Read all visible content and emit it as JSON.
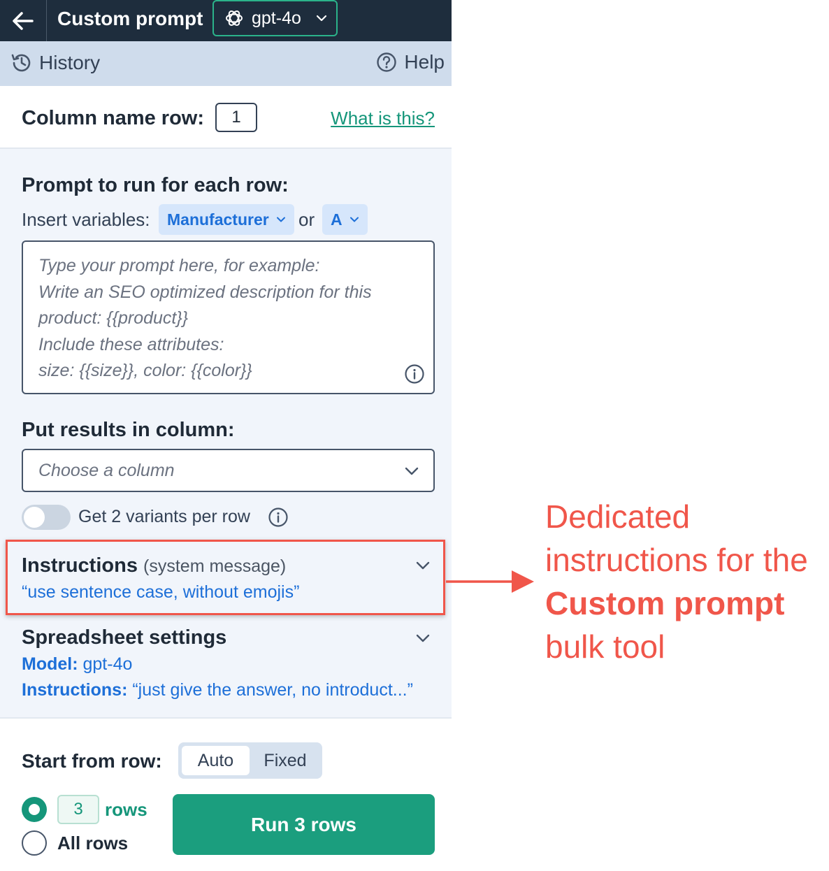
{
  "header": {
    "title": "Custom prompt",
    "model": "gpt-4o"
  },
  "toolbar": {
    "history_label": "History",
    "help_label": "Help"
  },
  "column_name_row": {
    "label": "Column name row:",
    "value": "1",
    "link": "What is this?"
  },
  "prompt": {
    "heading": "Prompt to run for each row:",
    "insert_label": "Insert variables:",
    "variable_1": "Manufacturer",
    "or_label": "or",
    "variable_2": "A",
    "placeholder": "Type your prompt here, for example:\nWrite an SEO optimized description for this\nproduct: {{product}}\nInclude these attributes:\nsize: {{size}}, color: {{color}}"
  },
  "results": {
    "heading": "Put results in column:",
    "placeholder": "Choose a column",
    "variants_label": "Get 2 variants per row",
    "variants_enabled": false
  },
  "instructions": {
    "title": "Instructions",
    "subtitle": "(system message)",
    "value": "“use sentence case, without emojis”"
  },
  "spreadsheet_settings": {
    "heading": "Spreadsheet settings",
    "model_key": "Model:",
    "model_value": "gpt-4o",
    "instructions_key": "Instructions:",
    "instructions_value": "“just give the answer, no introduct...”"
  },
  "start": {
    "label": "Start from row:",
    "option_auto": "Auto",
    "option_fixed": "Fixed",
    "selected": "Auto",
    "rows_value": "3",
    "rows_label": "rows",
    "all_rows_label": "All rows",
    "run_button": "Run 3 rows"
  },
  "annotation": {
    "line1": "Dedicated",
    "line2": "instructions for the",
    "line3_bold": "Custom prompt",
    "line4": "bulk tool"
  },
  "colors": {
    "header_bg": "#1e2d3d",
    "accent_green": "#1b9e7e",
    "link_blue": "#1d6fd8",
    "annotation_red": "#f0564a"
  }
}
